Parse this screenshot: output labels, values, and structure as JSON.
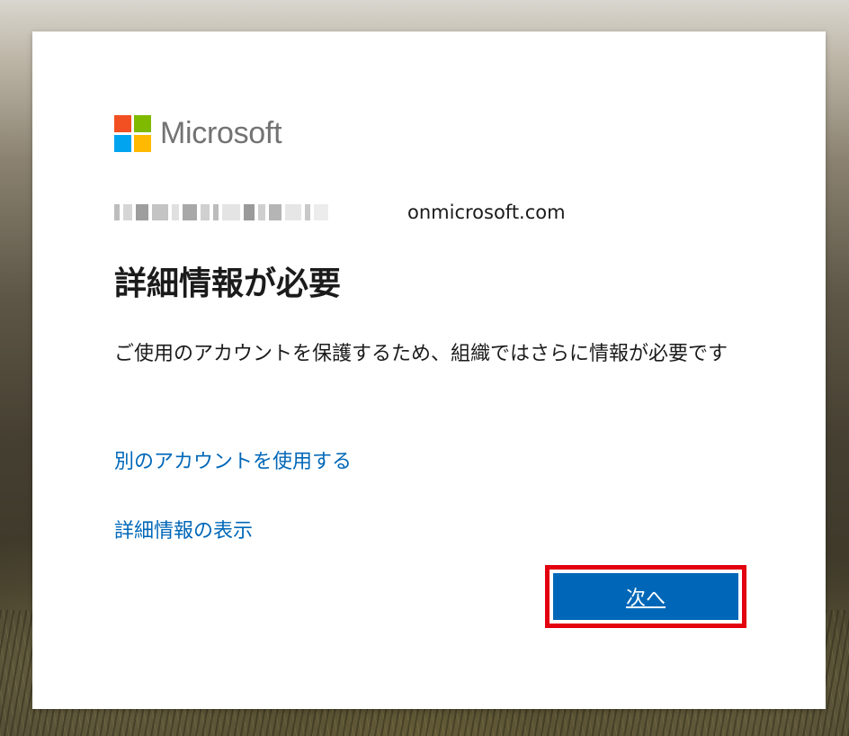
{
  "brand": {
    "name": "Microsoft",
    "logo_colors": [
      "#f25022",
      "#7fba00",
      "#00a4ef",
      "#ffb900"
    ]
  },
  "identity": {
    "domain": "onmicrosoft.com"
  },
  "page": {
    "title": "詳細情報が必要",
    "description": "ご使用のアカウントを保護するため、組織ではさらに情報が必要です"
  },
  "links": {
    "use_other_account": "別のアカウントを使用する",
    "more_info": "詳細情報の表示"
  },
  "actions": {
    "next_label": "次へ"
  },
  "colors": {
    "accent": "#0067b8",
    "highlight_border": "#e3000f"
  }
}
